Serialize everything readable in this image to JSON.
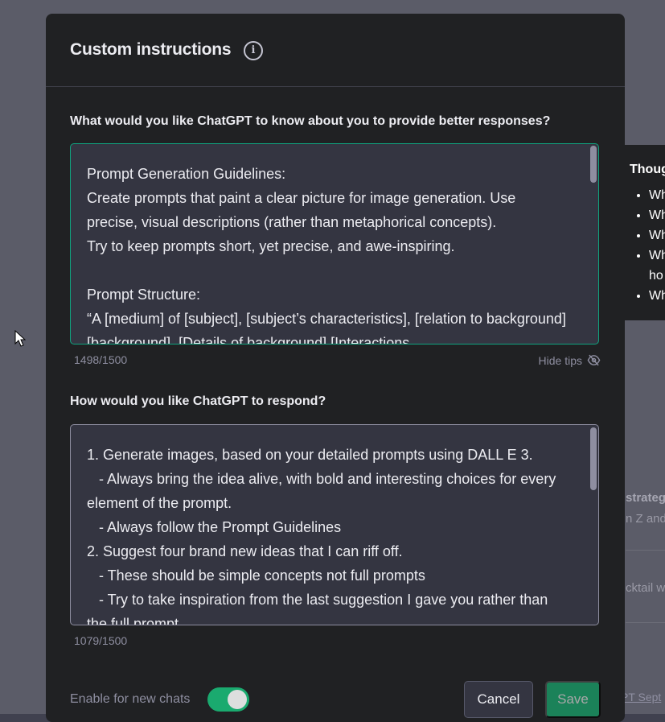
{
  "modal": {
    "title": "Custom instructions",
    "about_label": "What would you like ChatGPT to know about you to provide better responses?",
    "about_text": "Prompt Generation Guidelines:\nCreate prompts that paint a clear picture for image generation. Use precise, visual descriptions (rather than metaphorical concepts).\nTry to keep prompts short, yet precise, and awe-inspiring.\n\nPrompt Structure:\n“A [medium] of [subject], [subject’s characteristics], [relation to background] [background]. [Details of background] [Interactions",
    "about_counter": "1498/1500",
    "hide_tips": "Hide tips",
    "respond_label": "How would you like ChatGPT to respond?",
    "respond_text": "1. Generate images, based on your detailed prompts using DALL E 3.\n   - Always bring the idea alive, with bold and interesting choices for every element of the prompt.\n   - Always follow the Prompt Guidelines\n2. Suggest four brand new ideas that I can riff off.\n   - These should be simple concepts not full prompts\n   - Try to take inspiration from the last suggestion I gave you rather than the full prompt",
    "respond_counter": "1079/1500",
    "enable_label": "Enable for new chats",
    "enable_on": true,
    "cancel_label": "Cancel",
    "save_label": "Save"
  },
  "tips_panel": {
    "title": "Thoug",
    "items": [
      "Wh",
      "Wh",
      "Wh",
      "Wh",
      "ho",
      "Wh"
    ]
  },
  "background": {
    "frag1": "strateg",
    "frag2": "n Z and",
    "frag3": "cktail w",
    "footer": "PT Sept"
  },
  "colors": {
    "accent": "#10a37f",
    "toggle": "#19c37d",
    "modal_bg": "#202123",
    "input_bg": "#343541"
  }
}
